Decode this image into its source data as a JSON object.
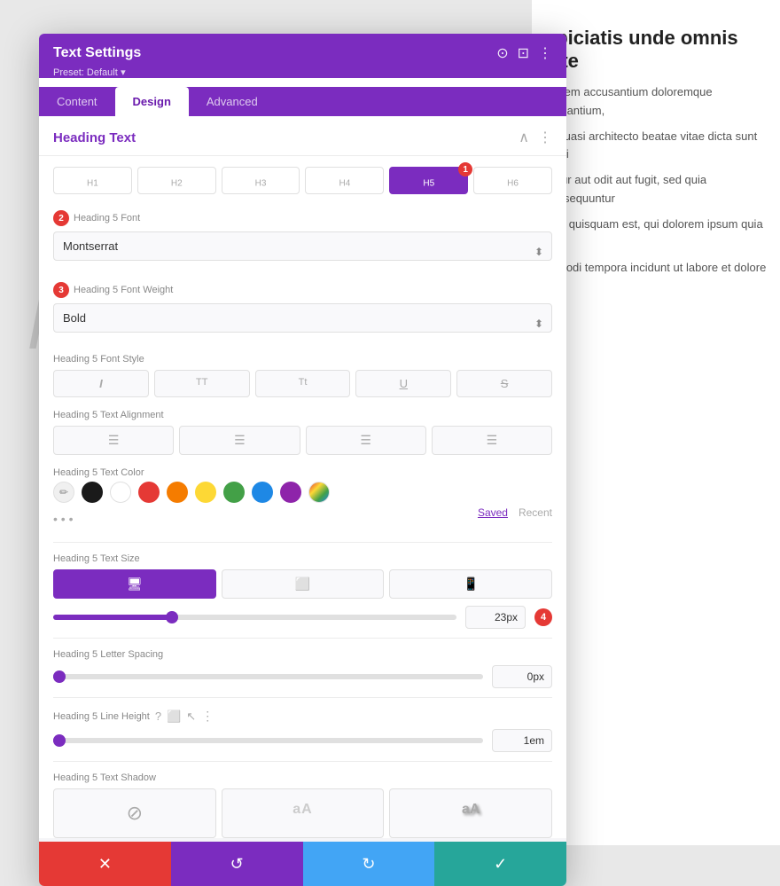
{
  "background": {
    "heading": "spiciatis unde omnis iste",
    "para1": "ptatem accusantium doloremque laudantium,",
    "para2": "et quasi architecto beatae vitae dicta sunt expli",
    "para3": "natur aut odit aut fugit, sed quia consequuntur",
    "para4": "orro quisquam est, qui dolorem ipsum quia dol",
    "para5": "is modi tempora incidunt ut labore et dolore m"
  },
  "modal": {
    "title": "Text Settings",
    "preset": "Preset: Default",
    "icons": {
      "target": "⊙",
      "layout": "⊡",
      "more": "⋮"
    },
    "tabs": [
      {
        "id": "content",
        "label": "Content"
      },
      {
        "id": "design",
        "label": "Design"
      },
      {
        "id": "advanced",
        "label": "Advanced"
      }
    ],
    "active_tab": "design",
    "section": {
      "title": "Heading Text"
    },
    "heading_tabs": [
      {
        "id": "h1",
        "label": "H₁"
      },
      {
        "id": "h2",
        "label": "H₂"
      },
      {
        "id": "h3",
        "label": "H₃"
      },
      {
        "id": "h4",
        "label": "H₄"
      },
      {
        "id": "h5",
        "label": "H₅",
        "active": true,
        "badge": "1"
      },
      {
        "id": "h6",
        "label": "H₆"
      }
    ],
    "font_field": {
      "label": "Heading 5 Font",
      "badge": "2",
      "value": "Montserrat"
    },
    "weight_field": {
      "label": "Heading 5 Font Weight",
      "badge": "3",
      "value": "Bold"
    },
    "style_field": {
      "label": "Heading 5 Font Style",
      "buttons": [
        {
          "id": "italic",
          "label": "I",
          "style": "italic"
        },
        {
          "id": "uppercase",
          "label": "TT"
        },
        {
          "id": "capitalize",
          "label": "Tt"
        },
        {
          "id": "underline",
          "label": "U"
        },
        {
          "id": "strikethrough",
          "label": "S"
        }
      ]
    },
    "align_field": {
      "label": "Heading 5 Text Alignment",
      "buttons": [
        {
          "id": "left",
          "label": "≡"
        },
        {
          "id": "center",
          "label": "≡"
        },
        {
          "id": "right",
          "label": "≡"
        },
        {
          "id": "justify",
          "label": "≡"
        }
      ]
    },
    "color_field": {
      "label": "Heading 5 Text Color",
      "swatches": [
        {
          "id": "eyedropper",
          "type": "eyedropper",
          "label": "🖊"
        },
        {
          "id": "black",
          "color": "#1a1a1a"
        },
        {
          "id": "white",
          "color": "#ffffff"
        },
        {
          "id": "red",
          "color": "#e53935"
        },
        {
          "id": "orange",
          "color": "#f57c00"
        },
        {
          "id": "yellow",
          "color": "#fdd835"
        },
        {
          "id": "green",
          "color": "#43a047"
        },
        {
          "id": "blue",
          "color": "#1e88e5"
        },
        {
          "id": "purple",
          "color": "#8e24aa"
        },
        {
          "id": "custom",
          "color": "linear-gradient",
          "label": "🖊"
        }
      ],
      "tabs": [
        "Saved",
        "Recent"
      ]
    },
    "size_field": {
      "label": "Heading 5 Text Size",
      "devices": [
        {
          "id": "desktop",
          "icon": "🖥",
          "active": true
        },
        {
          "id": "tablet",
          "icon": "⬜"
        },
        {
          "id": "mobile",
          "icon": "📱"
        }
      ],
      "slider_value": 23,
      "slider_pct": 30,
      "value": "23px",
      "badge": "4"
    },
    "letter_spacing_field": {
      "label": "Heading 5 Letter Spacing",
      "value": "0px",
      "slider_pct": 1
    },
    "line_height_field": {
      "label": "Heading 5 Line Height",
      "value": "1em",
      "slider_pct": 1,
      "has_help": true
    },
    "shadow_field": {
      "label": "Heading 5 Text Shadow",
      "options": [
        {
          "id": "none",
          "icon": "⊘",
          "active": true
        },
        {
          "id": "shadow1",
          "label": "aA"
        },
        {
          "id": "shadow2",
          "label": "aA"
        }
      ]
    }
  },
  "footer": {
    "cancel_icon": "✕",
    "reset_icon": "↺",
    "redo_icon": "↻",
    "save_icon": "✓"
  }
}
